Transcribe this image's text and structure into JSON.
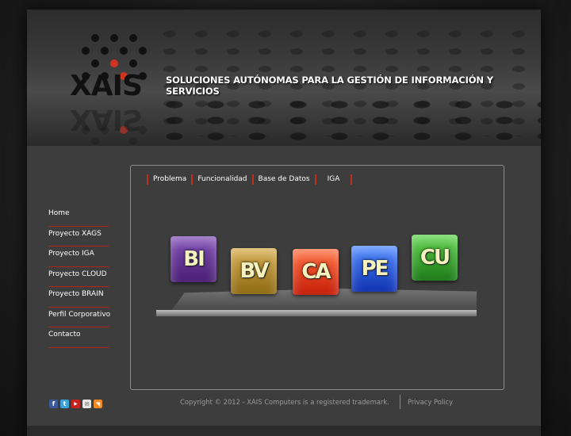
{
  "header": {
    "logo_text": "XAIS",
    "tagline": "SOLUCIONES AUTÓNOMAS PARA LA GESTIÓN DE INFORMACIÓN Y SERVICIOS"
  },
  "sidebar": {
    "items": [
      {
        "label": "Home"
      },
      {
        "label": "Proyecto XAGS"
      },
      {
        "label": "Proyecto IGA"
      },
      {
        "label": "Proyecto CLOUD"
      },
      {
        "label": "Proyecto BRAIN"
      },
      {
        "label": "Perfil Corporativo"
      },
      {
        "label": "Contacto"
      }
    ]
  },
  "tabs": [
    {
      "label": "Problema"
    },
    {
      "label": "Funcionalidad"
    },
    {
      "label": "Base de Datos"
    },
    {
      "label": "IGA"
    }
  ],
  "tiles": [
    {
      "label": "BI",
      "color": "#5a2a8a"
    },
    {
      "label": "BV",
      "color": "#b58a22"
    },
    {
      "label": "CA",
      "color": "#e0361a"
    },
    {
      "label": "PE",
      "color": "#1a52d8"
    },
    {
      "label": "CU",
      "color": "#2fa02a"
    }
  ],
  "footer": {
    "social_icons": [
      "facebook-icon",
      "twitter-icon",
      "youtube-icon",
      "email-icon",
      "rss-icon"
    ],
    "copyright": "Copyright © 2012 - XAIS Computers is a registered trademark.",
    "privacy": "Privacy Policy"
  },
  "colors": {
    "accent": "#b52318",
    "background": "#3d3d3d"
  }
}
